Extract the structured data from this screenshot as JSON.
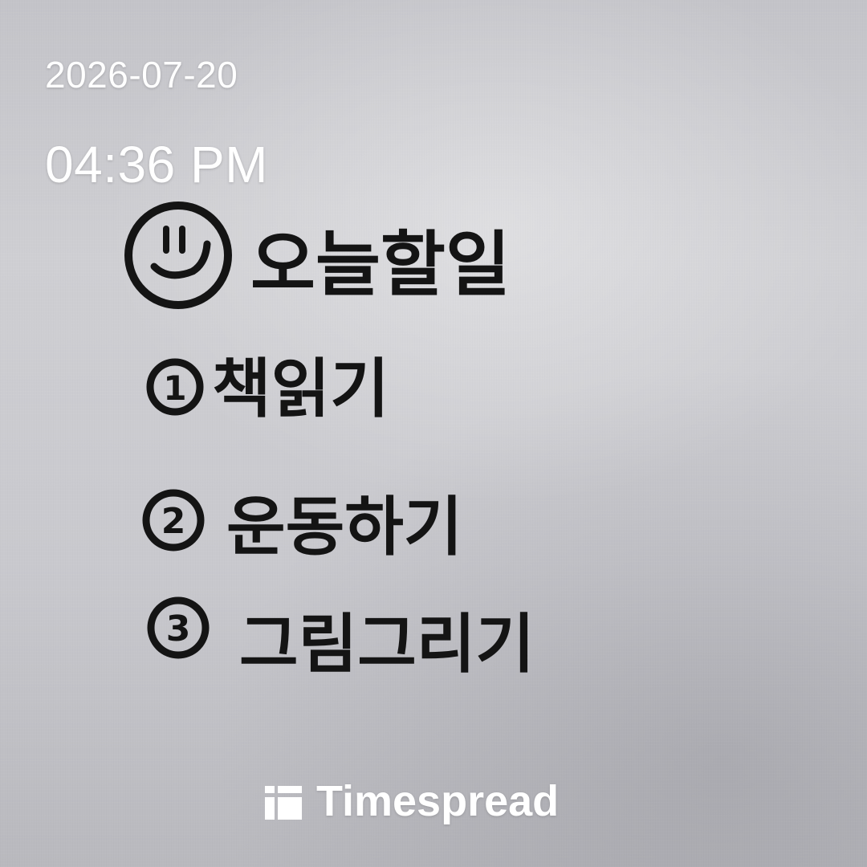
{
  "timestamp": {
    "date": "2026-07-20",
    "time": "04:36 PM"
  },
  "note": {
    "title": "오늘할일",
    "title_icon": "smiley-face-icon",
    "items": [
      {
        "number": "1",
        "text": "책읽기"
      },
      {
        "number": "2",
        "text": "운동하기"
      },
      {
        "number": "3",
        "text": "그림그리기"
      }
    ]
  },
  "watermark": {
    "brand": "Timespread",
    "logo_icon": "timespread-logo-icon"
  },
  "colors": {
    "ink": "#141414",
    "paper": "#cbcbcf",
    "overlay_text": "#ffffff"
  }
}
